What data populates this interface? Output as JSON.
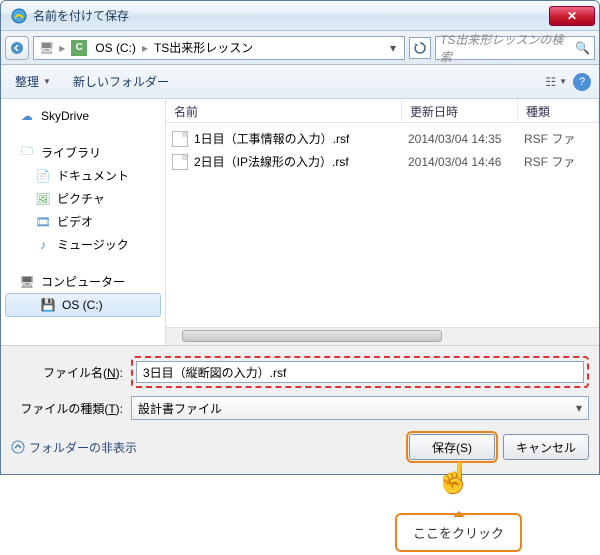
{
  "window": {
    "title": "名前を付けて保存"
  },
  "address": {
    "drive": "OS (C:)",
    "folder": "TS出来形レッスン",
    "search_placeholder": "TS出来形レッスンの検索"
  },
  "toolbar": {
    "organize": "整理",
    "new_folder": "新しいフォルダー"
  },
  "nav": {
    "skydrive": "SkyDrive",
    "library": "ライブラリ",
    "documents": "ドキュメント",
    "pictures": "ピクチャ",
    "videos": "ビデオ",
    "music": "ミュージック",
    "computer": "コンピューター",
    "drive": "OS (C:)"
  },
  "headers": {
    "name": "名前",
    "date": "更新日時",
    "type": "種類"
  },
  "files": [
    {
      "name": "1日目（工事情報の入力）.rsf",
      "date": "2014/03/04 14:35",
      "type": "RSF ファ"
    },
    {
      "name": "2日目（IP法線形の入力）.rsf",
      "date": "2014/03/04 14:46",
      "type": "RSF ファ"
    }
  ],
  "fields": {
    "filename_label_pre": "ファイル名(",
    "filename_label_u": "N",
    "filename_label_post": "):",
    "filename_value": "3日目（縦断図の入力）.rsf",
    "filetype_label_pre": "ファイルの種類(",
    "filetype_label_u": "T",
    "filetype_label_post": "):",
    "filetype_value": "設計書ファイル"
  },
  "footer": {
    "hide_folders": "フォルダーの非表示",
    "save": "保存(S)",
    "cancel": "キャンセル"
  },
  "annotation": {
    "callout": "ここをクリック"
  }
}
